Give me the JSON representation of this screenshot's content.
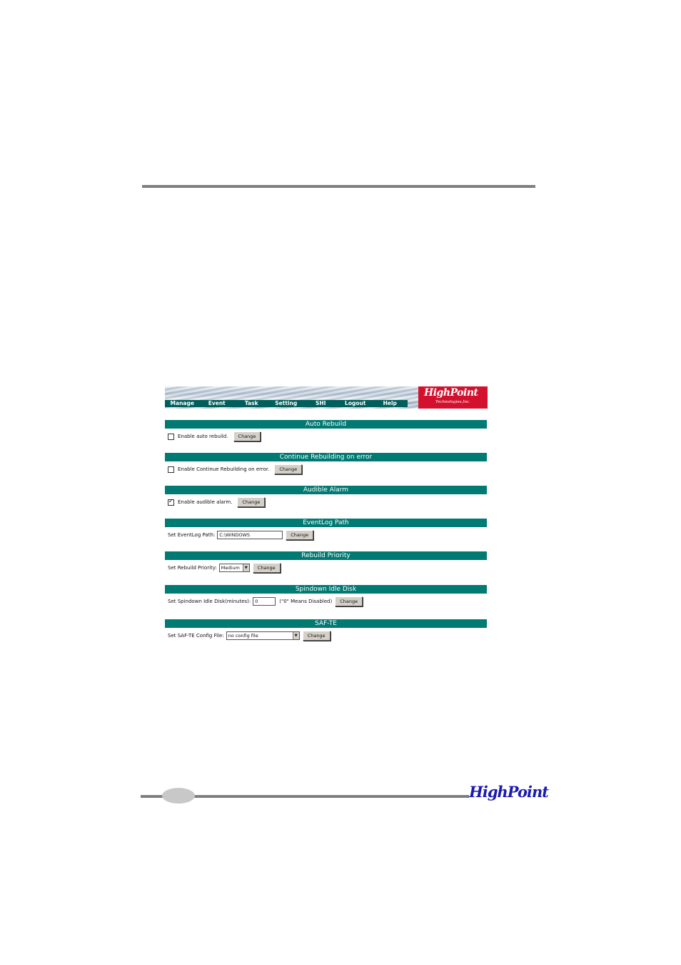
{
  "nav": {
    "items": [
      "Manage",
      "Event",
      "Task",
      "Setting",
      "SHI",
      "Logout",
      "Help"
    ]
  },
  "logo": {
    "brand": "HighPoint",
    "subtitle": "Technologies,Inc."
  },
  "sections": {
    "auto_rebuild": {
      "title": "Auto Rebuild",
      "checkbox_label": "Enable auto rebuild.",
      "checked": false,
      "button": "Change"
    },
    "continue_rebuilding": {
      "title": "Continue Rebuilding on error",
      "checkbox_label": "Enable Continue Rebuilding on error.",
      "checked": false,
      "button": "Change"
    },
    "audible_alarm": {
      "title": "Audible Alarm",
      "checkbox_label": "Enable audible alarm.",
      "checked": true,
      "button": "Change"
    },
    "eventlog_path": {
      "title": "EventLog Path",
      "label": "Set EventLog Path:",
      "value": "C:\\WINDOWS",
      "button": "Change"
    },
    "rebuild_priority": {
      "title": "Rebuild Priority",
      "label": "Set Rebuild Priority:",
      "selected": "Medium",
      "button": "Change"
    },
    "spindown": {
      "title": "Spindown Idle Disk",
      "label": "Set Spindown Idle Disk(minutes):",
      "value": "0",
      "note": "(\"0\" Means Disabled)",
      "button": "Change"
    },
    "safte": {
      "title": "SAF-TE",
      "label": "Set SAF-TE Config File:",
      "selected": "no config file",
      "button": "Change"
    }
  },
  "footer": {
    "brand": "HighPoint"
  }
}
